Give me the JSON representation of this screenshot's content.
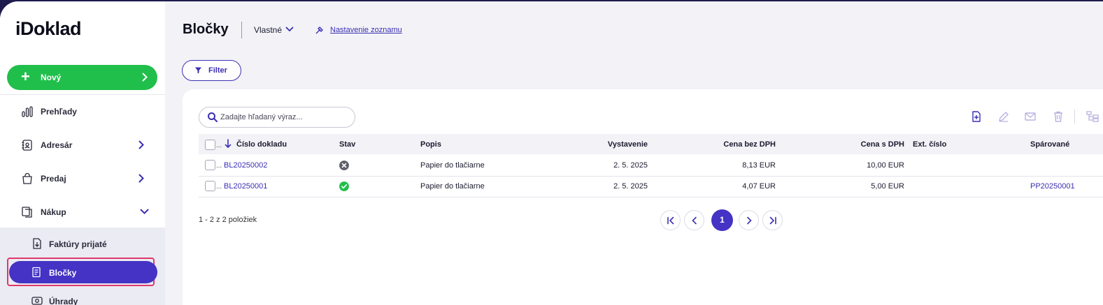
{
  "app": {
    "logo": "iDoklad"
  },
  "sidebar": {
    "new_label": "Nový",
    "items": [
      {
        "label": "Prehľady"
      },
      {
        "label": "Adresár"
      },
      {
        "label": "Predaj"
      },
      {
        "label": "Nákup"
      }
    ],
    "sub_items": [
      {
        "label": "Faktúry prijaté"
      },
      {
        "label": "Bločky"
      },
      {
        "label": "Úhrady"
      }
    ]
  },
  "header": {
    "title": "Bločky",
    "view": "Vlastné",
    "list_settings": "Nastavenie zoznamu"
  },
  "filter": {
    "label": "Filter"
  },
  "search": {
    "placeholder": "Zadajte hľadaný výraz..."
  },
  "table": {
    "columns": [
      "Číslo dokladu",
      "Stav",
      "Popis",
      "Vystavenie",
      "Cena bez DPH",
      "Cena s DPH",
      "Ext. číslo",
      "Spárované"
    ],
    "rows": [
      {
        "number": "BL20250002",
        "status": "cancelled",
        "description": "Papier do tlačiarne",
        "issued": "2. 5. 2025",
        "price_net": "8,13 EUR",
        "price_gross": "10,00 EUR",
        "ext": "",
        "paired": ""
      },
      {
        "number": "BL20250001",
        "status": "ok",
        "description": "Papier do tlačiarne",
        "issued": "2. 5. 2025",
        "price_net": "4,07 EUR",
        "price_gross": "5,00 EUR",
        "ext": "",
        "paired": "PP20250001"
      }
    ],
    "row_dots": "..."
  },
  "pagination": {
    "summary": "1 - 2 z 2 položiek",
    "current_page": "1"
  },
  "colors": {
    "accent": "#4433c4",
    "green": "#20bf4b",
    "highlight": "#e0386a",
    "status_ok": "#20bf4b",
    "status_cancelled": "#5f5f6b"
  }
}
